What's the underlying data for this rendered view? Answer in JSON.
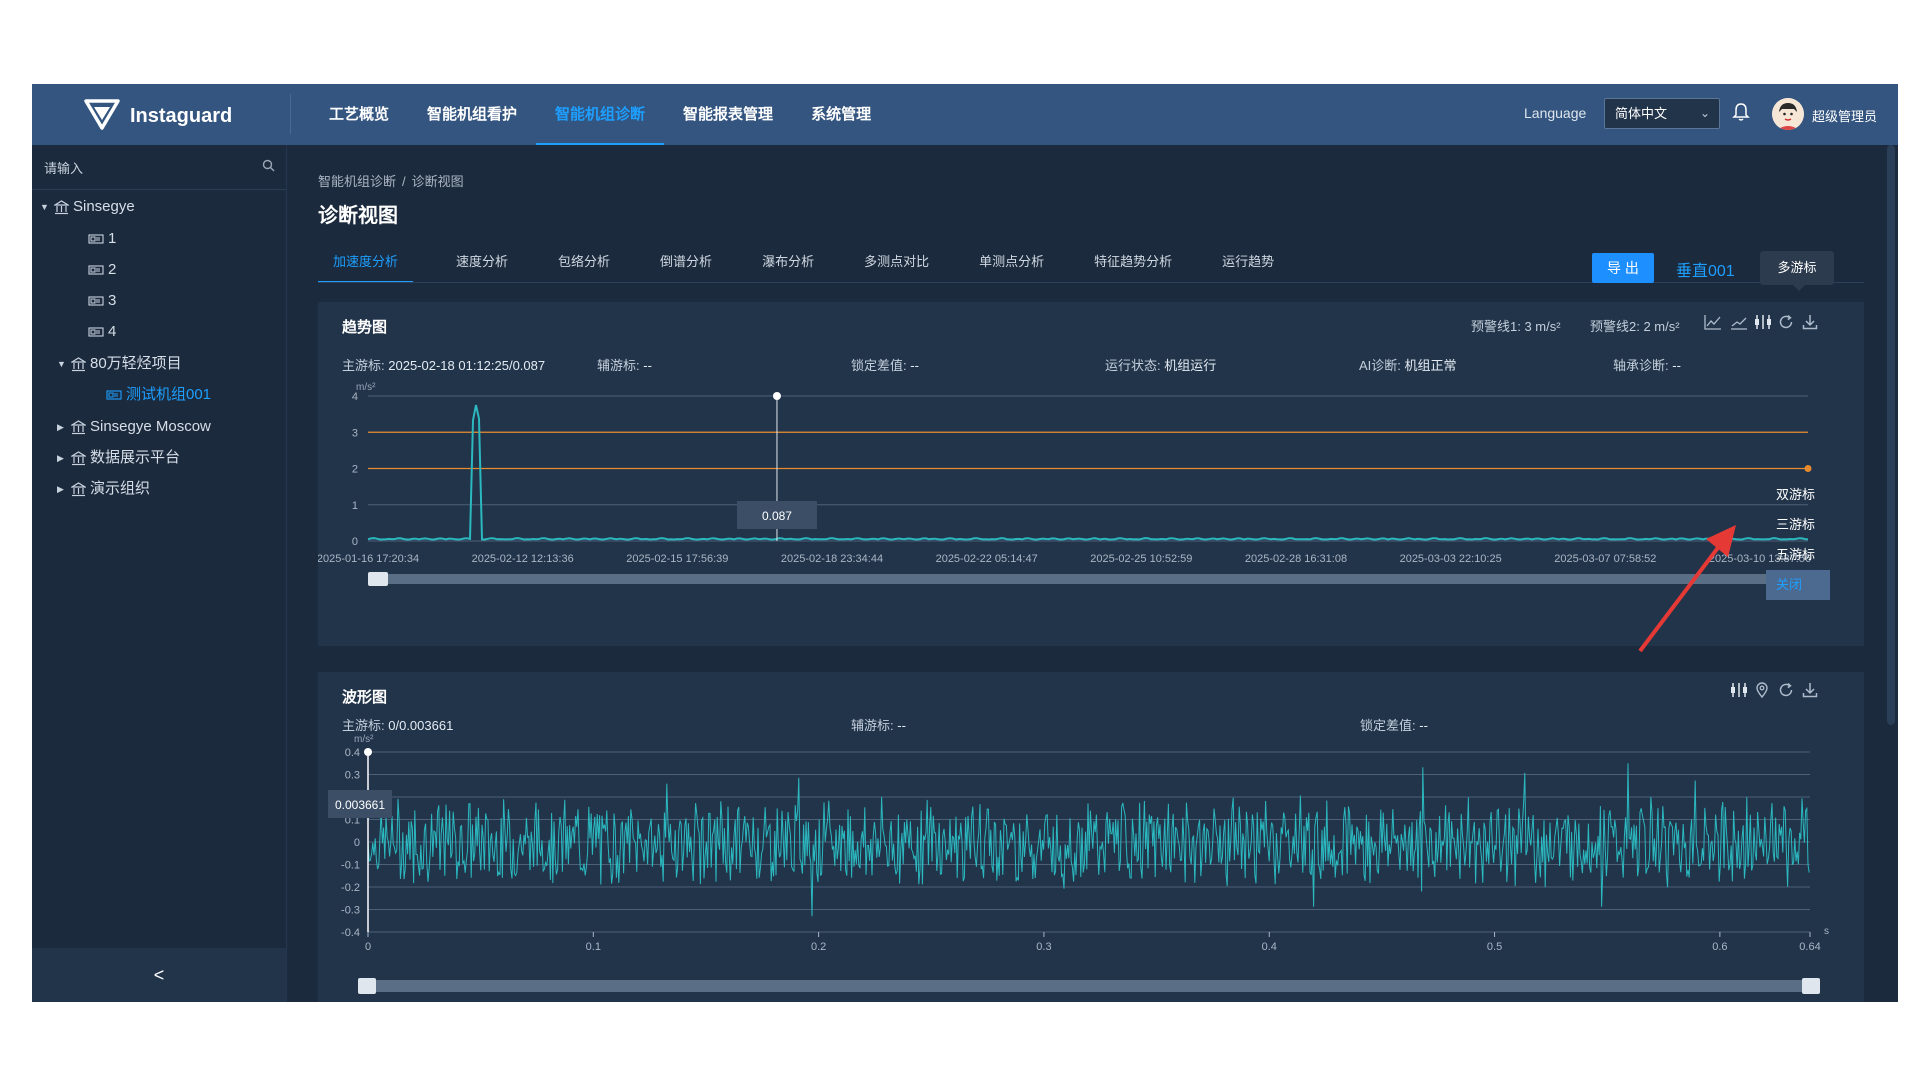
{
  "header": {
    "logo_text": "Instaguard",
    "nav": [
      "工艺概览",
      "智能机组看护",
      "智能机组诊断",
      "智能报表管理",
      "系统管理"
    ],
    "active_nav": 2,
    "language_label": "Language",
    "language_value": "简体中文",
    "user_name": "超级管理员"
  },
  "sidebar": {
    "search_placeholder": "请输入",
    "tree": [
      {
        "label": "Sinsegye",
        "level": 0,
        "arrow": "down",
        "icon": "org-icon"
      },
      {
        "label": "1",
        "level": 2,
        "arrow": "",
        "icon": "device-icon"
      },
      {
        "label": "2",
        "level": 2,
        "arrow": "",
        "icon": "device-icon"
      },
      {
        "label": "3",
        "level": 2,
        "arrow": "",
        "icon": "device-icon"
      },
      {
        "label": "4",
        "level": 2,
        "arrow": "",
        "icon": "device-icon"
      },
      {
        "label": "80万轻烃项目",
        "level": 1,
        "arrow": "down",
        "icon": "org-icon"
      },
      {
        "label": "测试机组001",
        "level": 3,
        "arrow": "",
        "icon": "device-icon",
        "selected": true
      },
      {
        "label": "Sinsegye Moscow",
        "level": 1,
        "arrow": "right",
        "icon": "org-icon"
      },
      {
        "label": "数据展示平台",
        "level": 1,
        "arrow": "right",
        "icon": "org-icon"
      },
      {
        "label": "演示组织",
        "level": 1,
        "arrow": "right",
        "icon": "org-icon"
      }
    ],
    "collapse_label": "<"
  },
  "main": {
    "breadcrumb": [
      "智能机组诊断",
      "诊断视图"
    ],
    "title": "诊断视图",
    "tabs": [
      "加速度分析",
      "速度分析",
      "包络分析",
      "倒谱分析",
      "瀑布分析",
      "多测点对比",
      "单测点分析",
      "特征趋势分析",
      "运行趋势"
    ],
    "active_tab": 0,
    "export_label": "导 出",
    "measure_point": "垂直001",
    "tooltip": "多游标"
  },
  "trend": {
    "title": "趋势图",
    "warn1_label": "预警线1:",
    "warn1_value": "3 m/s²",
    "warn2_label": "预警线2:",
    "warn2_value": "2 m/s²",
    "main_cursor_label": "主游标:",
    "main_cursor_value": "2025-02-18 01:12:25/0.087",
    "aux_cursor_label": "辅游标:",
    "aux_cursor_value": "--",
    "lock_diff_label": "锁定差值:",
    "lock_diff_value": "--",
    "run_state_label": "运行状态:",
    "run_state_value": "机组运行",
    "ai_label": "AI诊断:",
    "ai_value": "机组正常",
    "bearing_label": "轴承诊断:",
    "bearing_value": "--",
    "cursor_menu": [
      "双游标",
      "三游标",
      "五游标",
      "关闭"
    ],
    "cursor_menu_highlight": 3
  },
  "waveform": {
    "title": "波形图",
    "main_cursor_label": "主游标:",
    "main_cursor_value": "0/0.003661",
    "aux_cursor_label": "辅游标:",
    "aux_cursor_value": "--",
    "lock_diff_label": "锁定差值:",
    "lock_diff_value": "--"
  },
  "colors": {
    "accent": "#1e9fff",
    "series": "#2bb8bf",
    "warning": "#e58a2e",
    "header": "#33557f"
  },
  "chart_data": [
    {
      "type": "line",
      "title": "趋势图",
      "ylabel": "m/s²",
      "ylim": [
        0,
        4
      ],
      "yticks": [
        0,
        1,
        2,
        3,
        4
      ],
      "xticks": [
        "2025-01-16 17:20:34",
        "2025-02-12 12:13:36",
        "2025-02-15 17:56:39",
        "2025-02-18 23:34:44",
        "2025-02-22 05:14:47",
        "2025-02-25 10:52:59",
        "2025-02-28 16:31:08",
        "2025-03-03 22:10:25",
        "2025-03-07 07:58:52",
        "2025-03-10 13:37:56"
      ],
      "series": [
        {
          "values_description": "baseline near 0.05 with a spike to ~3.8 near 2025-02-12"
        }
      ],
      "threshold_lines": [
        {
          "value": 3
        },
        {
          "value": 2
        }
      ],
      "cursor": {
        "x": "2025-02-18 01:12:25",
        "y": 0.087
      },
      "cursor_label": "0.087"
    },
    {
      "type": "line",
      "title": "波形图",
      "ylabel": "m/s²",
      "xlabel": "s",
      "ylim": [
        -0.4,
        0.4
      ],
      "xlim": [
        0,
        0.64
      ],
      "yticks": [
        "0.4",
        "0.3",
        "0.2",
        "0.1",
        "0",
        "-0.1",
        "-0.2",
        "-0.3",
        "-0.4"
      ],
      "xticks": [
        "0",
        "0.1",
        "0.2",
        "0.3",
        "0.4",
        "0.5",
        "0.6",
        "0.64"
      ],
      "cursor": {
        "x": 0,
        "y": 0.003661
      },
      "cursor_label": "0.003661"
    }
  ]
}
